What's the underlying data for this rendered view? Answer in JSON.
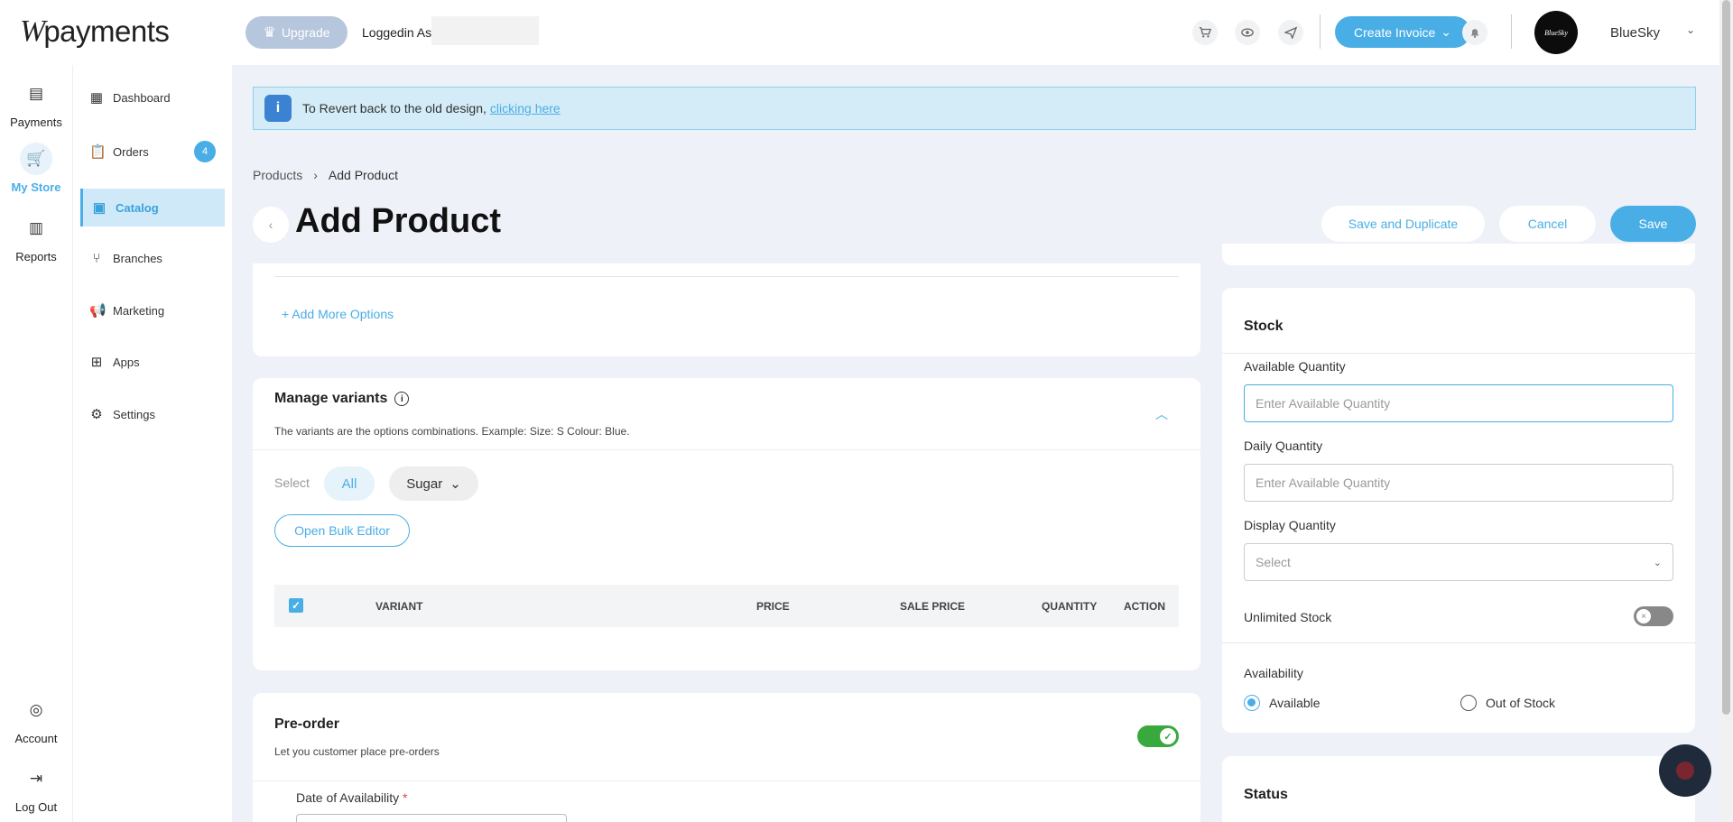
{
  "brand": {
    "mark": "W",
    "name": "payments"
  },
  "header": {
    "upgrade_label": "Upgrade",
    "logged_in_label": "Loggedin As",
    "create_invoice_label": "Create Invoice",
    "avatar_text": "BlueSky",
    "user_name": "BlueSky"
  },
  "rail": {
    "items": [
      {
        "label": "Payments",
        "icon": "receipt-icon"
      },
      {
        "label": "My Store",
        "icon": "cart-icon"
      },
      {
        "label": "Reports",
        "icon": "bar-chart-icon"
      },
      {
        "label": "Account",
        "icon": "account-icon"
      },
      {
        "label": "Log Out",
        "icon": "logout-icon"
      }
    ],
    "active": "My Store"
  },
  "sidebar": {
    "items": [
      {
        "label": "Dashboard",
        "icon": "grid-icon"
      },
      {
        "label": "Orders",
        "icon": "clipboard-icon",
        "badge": "4"
      },
      {
        "label": "Catalog",
        "icon": "catalog-icon"
      },
      {
        "label": "Branches",
        "icon": "branch-icon"
      },
      {
        "label": "Marketing",
        "icon": "megaphone-icon"
      },
      {
        "label": "Apps",
        "icon": "apps-icon"
      },
      {
        "label": "Settings",
        "icon": "gear-icon"
      }
    ],
    "active": "Catalog"
  },
  "notice": {
    "icon": "i",
    "text": "To Revert back to the old design,",
    "link": "clicking here"
  },
  "breadcrumb": {
    "parent": "Products",
    "current": "Add Product"
  },
  "page": {
    "title": "Add Product",
    "save_duplicate_label": "Save and Duplicate",
    "cancel_label": "Cancel",
    "save_label": "Save"
  },
  "options": {
    "add_more_label": "+ Add More Options"
  },
  "variants": {
    "title": "Manage variants",
    "description": "The variants are the options combinations. Example: Size: S Colour: Blue.",
    "select_label": "Select",
    "filter_all": "All",
    "filter_sugar": "Sugar",
    "bulk_editor_label": "Open Bulk Editor",
    "columns": [
      "VARIANT",
      "PRICE",
      "SALE PRICE",
      "QUANTITY",
      "ACTION"
    ]
  },
  "preorder": {
    "title": "Pre-order",
    "description": "Let you customer place pre-orders",
    "enabled": true,
    "date_label": "Date of Availability",
    "required_mark": "*"
  },
  "stock": {
    "title": "Stock",
    "available_qty_label": "Available Quantity",
    "available_qty_placeholder": "Enter Available Quantity",
    "daily_qty_label": "Daily Quantity",
    "daily_qty_placeholder": "Enter Available Quantity",
    "display_qty_label": "Display Quantity",
    "display_qty_value": "Select",
    "unlimited_label": "Unlimited Stock",
    "unlimited_enabled": false,
    "availability_label": "Availability",
    "availability_options": [
      "Available",
      "Out of Stock"
    ],
    "availability_selected": "Available"
  },
  "status": {
    "title": "Status"
  },
  "colors": {
    "accent": "#4aaee6",
    "toggle_on": "#38a93c",
    "notice_bg": "#d3ecf7"
  }
}
